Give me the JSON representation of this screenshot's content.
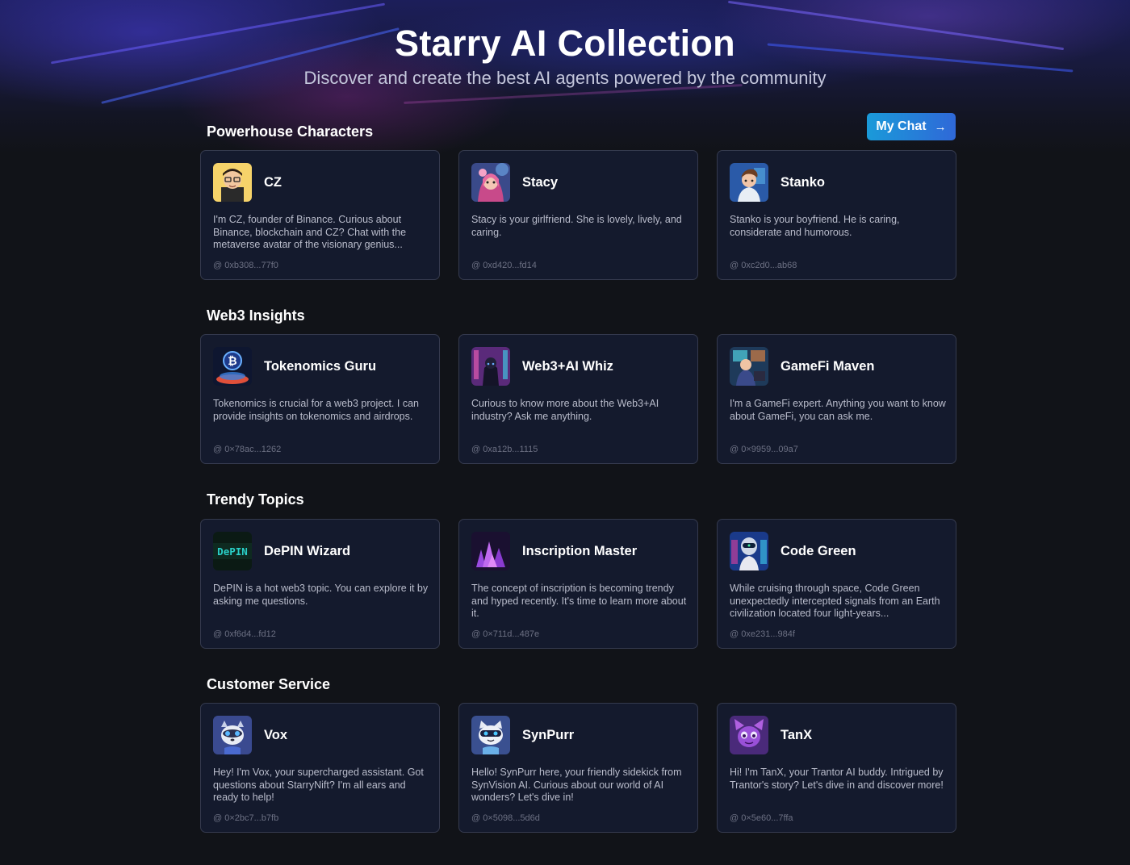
{
  "header": {
    "title": "Starry AI Collection",
    "subtitle": "Discover and create the best AI agents powered by the community"
  },
  "my_chat": {
    "label": "My Chat",
    "arrow": "→"
  },
  "colors": {
    "background": "#111318",
    "card_bg": "#141a2d",
    "card_border": "#353a4e",
    "button_gradient_start": "#1a9ad9",
    "button_gradient_end": "#2f68d8"
  },
  "sections": [
    {
      "title": "Powerhouse Characters",
      "cards": [
        {
          "name": "CZ",
          "description": "I'm CZ, founder of Binance. Curious about Binance, blockchain and CZ? Chat with the metaverse avatar of the visionary genius...",
          "address": "@ 0xb308...77f0",
          "icon": "cz-avatar"
        },
        {
          "name": "Stacy",
          "description": "Stacy is your girlfriend. She is lovely, lively, and caring.",
          "address": "@ 0xd420...fd14",
          "icon": "stacy-avatar"
        },
        {
          "name": "Stanko",
          "description": "Stanko is your boyfriend. He is caring, considerate and humorous.",
          "address": "@ 0xc2d0...ab68",
          "icon": "stanko-avatar"
        }
      ]
    },
    {
      "title": "Web3 Insights",
      "cards": [
        {
          "name": "Tokenomics Guru",
          "description": "Tokenomics is crucial for a web3 project. I can provide insights on tokenomics and airdrops.",
          "address": "@ 0×78ac...1262",
          "icon": "bitcoin-avatar"
        },
        {
          "name": "Web3+AI Whiz",
          "description": "Curious to know more about the Web3+AI industry? Ask me anything.",
          "address": "@ 0xa12b...1115",
          "icon": "hacker-avatar"
        },
        {
          "name": "GameFi Maven",
          "description": "I'm a GameFi expert. Anything you want to know about GameFi, you can ask me.",
          "address": "@ 0×9959...09a7",
          "icon": "gamer-avatar"
        }
      ]
    },
    {
      "title": "Trendy Topics",
      "cards": [
        {
          "name": "DePIN Wizard",
          "description": "DePIN is a hot web3 topic. You can explore it by asking me questions.",
          "address": "@ 0xf6d4...fd12",
          "icon": "depin-avatar",
          "icon_text": "DePIN"
        },
        {
          "name": "Inscription Master",
          "description": "The concept of inscription is becoming trendy and hyped recently. It's time to learn more about it.",
          "address": "@ 0×711d...487e",
          "icon": "crystal-avatar"
        },
        {
          "name": "Code Green",
          "description": "While cruising through space, Code Green unexpectedly intercepted signals from an Earth civilization located four light-years...",
          "address": "@ 0xe231...984f",
          "icon": "alien-avatar"
        }
      ]
    },
    {
      "title": "Customer Service",
      "cards": [
        {
          "name": "Vox",
          "description": "Hey! I'm Vox, your supercharged assistant. Got questions about StarryNift? I'm all ears and ready to help!",
          "address": "@ 0×2bc7...b7fb",
          "icon": "raccoon-avatar"
        },
        {
          "name": "SynPurr",
          "description": "Hello! SynPurr here, your friendly sidekick from SynVision AI. Curious about our world of AI wonders? Let's dive in!",
          "address": "@ 0×5098...5d6d",
          "icon": "cat-avatar"
        },
        {
          "name": "TanX",
          "description": "Hi! I'm TanX, your Trantor AI buddy. Intrigued by Trantor's story? Let's dive in and discover more!",
          "address": "@ 0×5e60...7ffa",
          "icon": "purple-creature-avatar"
        }
      ]
    }
  ]
}
